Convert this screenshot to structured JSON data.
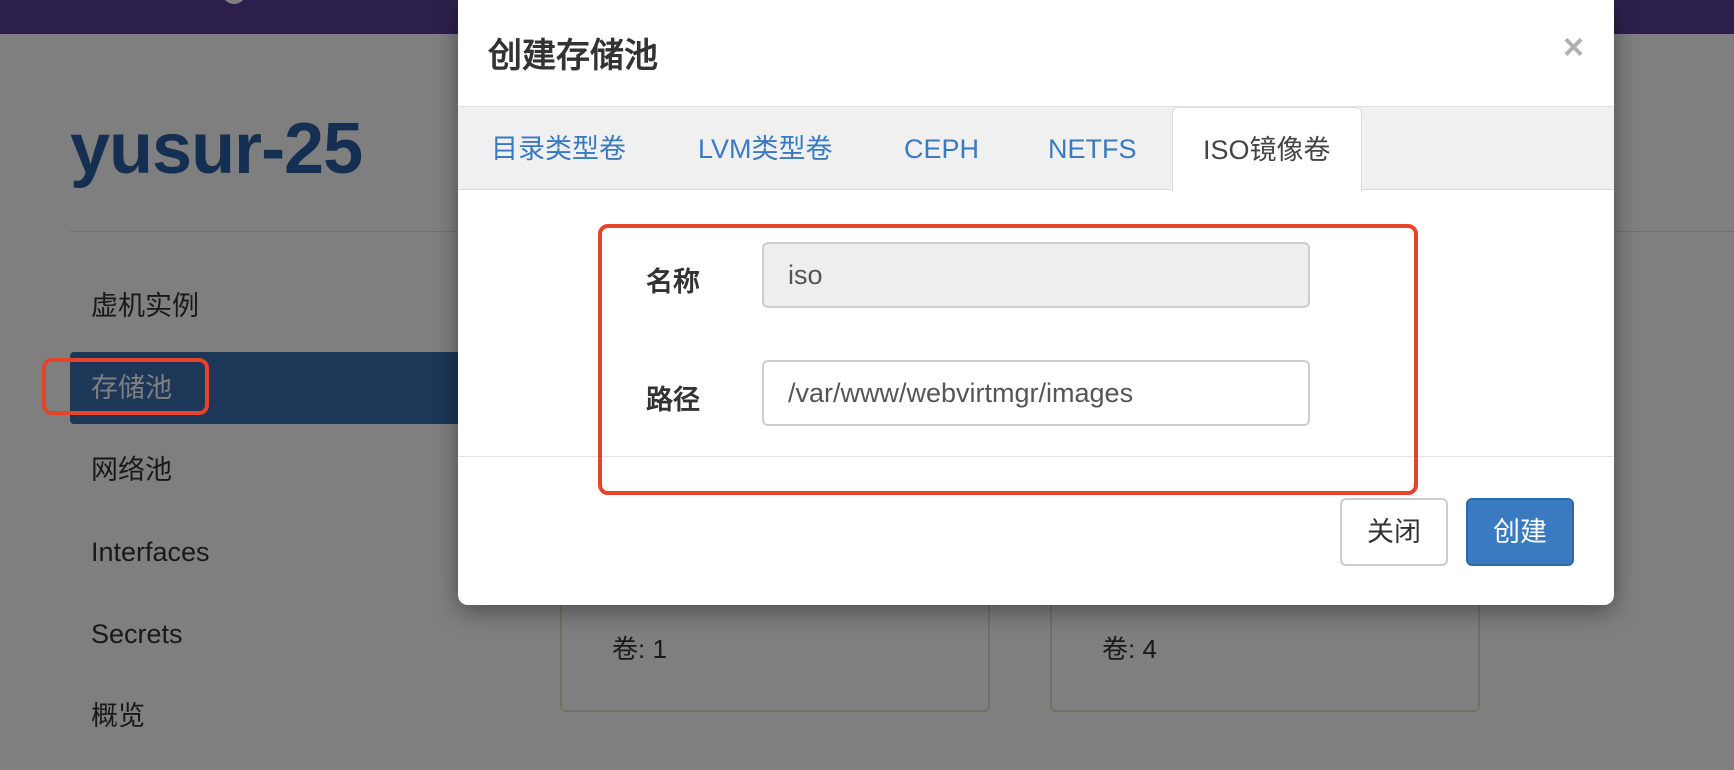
{
  "host": {
    "title": "yusur-25"
  },
  "sidebar": {
    "items": [
      {
        "label": "虚机实例"
      },
      {
        "label": "存储池"
      },
      {
        "label": "网络池"
      },
      {
        "label": "Interfaces"
      },
      {
        "label": "Secrets"
      },
      {
        "label": "概览"
      }
    ]
  },
  "cards": [
    {
      "text": "卷: 1"
    },
    {
      "text": "卷: 4"
    }
  ],
  "modal": {
    "title": "创建存储池",
    "close_symbol": "×",
    "tabs": [
      {
        "label": "目录类型卷"
      },
      {
        "label": "LVM类型卷"
      },
      {
        "label": "CEPH"
      },
      {
        "label": "NETFS"
      },
      {
        "label": "ISO镜像卷"
      }
    ],
    "active_tab": "ISO镜像卷",
    "form": {
      "name_label": "名称",
      "name_value": "iso",
      "path_label": "路径",
      "path_value": "/var/www/webvirtmgr/images"
    },
    "buttons": {
      "close_label": "关闭",
      "create_label": "创建"
    }
  },
  "colors": {
    "topbar": "#5a3f9a",
    "accent": "#3a7ac0",
    "highlight": "#e5432a"
  }
}
